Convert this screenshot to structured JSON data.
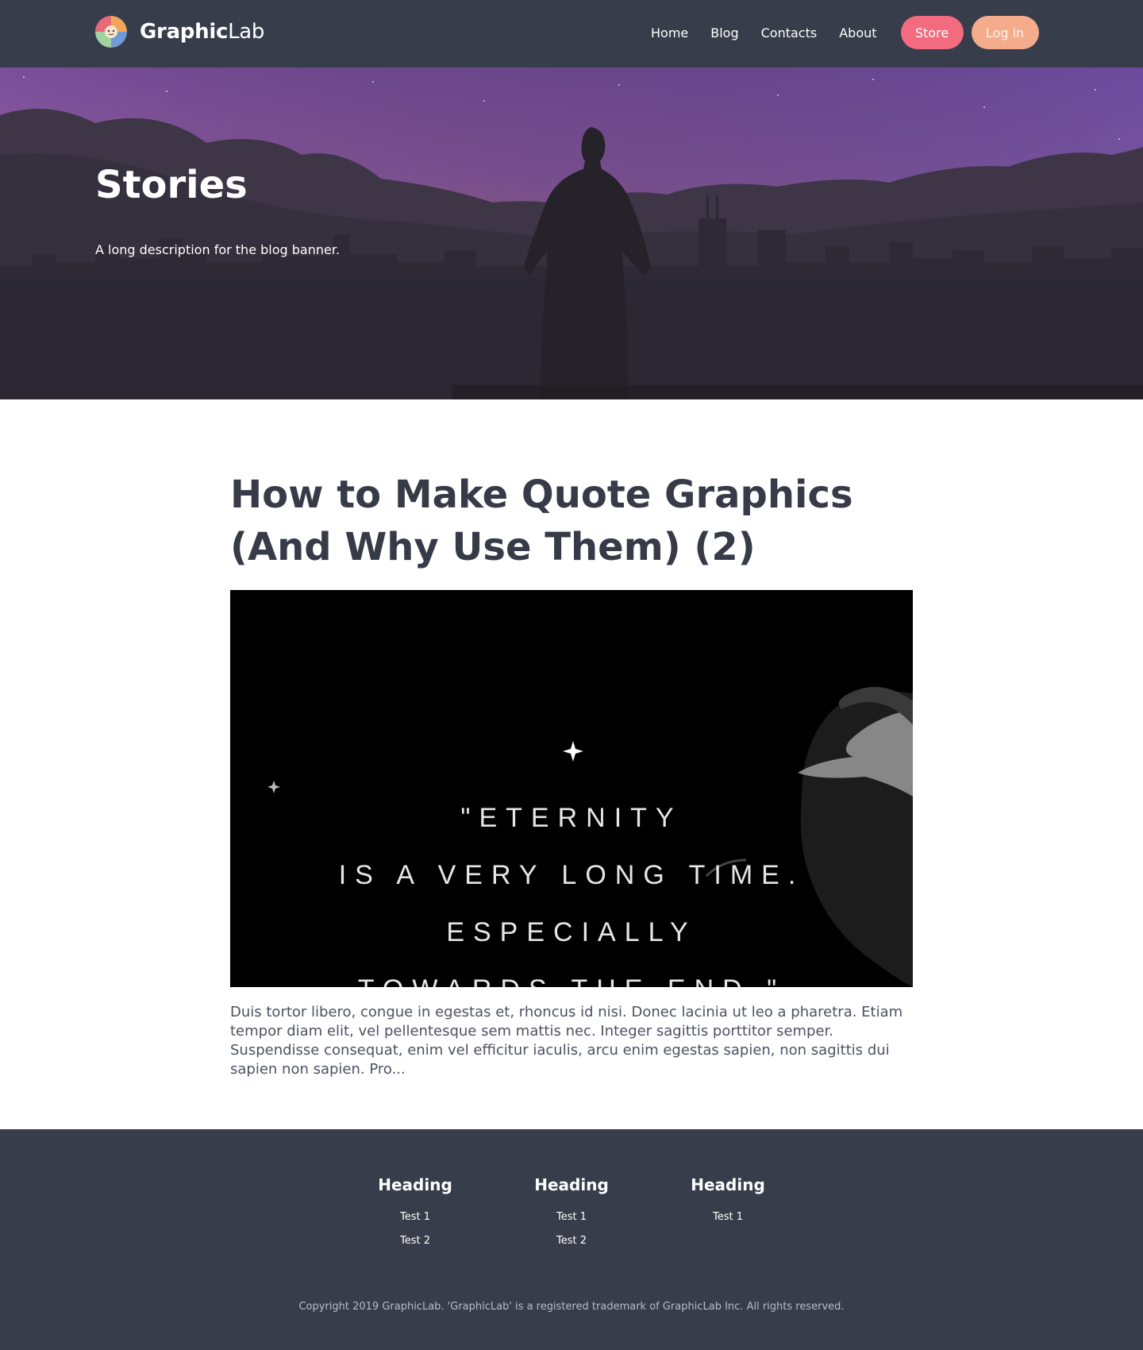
{
  "header": {
    "brand_bold": "Graphic",
    "brand_light": "Lab",
    "nav": [
      "Home",
      "Blog",
      "Contacts",
      "About"
    ],
    "store_label": "Store",
    "login_label": "Log in"
  },
  "hero": {
    "title": "Stories",
    "description": "A long description for the blog banner."
  },
  "article": {
    "title": "How to Make Quote Graphics (And Why Use Them) (2)",
    "image_quote_lines": [
      "\"ETERNITY",
      "IS A VERY LONG TIME.",
      "ESPECIALLY",
      "TOWARDS THE END.\""
    ],
    "excerpt": "Duis tortor libero, congue in egestas et, rhoncus id nisi. Donec lacinia ut leo a pharetra. Etiam tempor diam elit, vel pellentesque sem mattis nec. Integer sagittis porttitor semper. Suspendisse consequat, enim vel efficitur iaculis, arcu enim egestas sapien, non sagittis dui sapien non sapien. Pro..."
  },
  "footer": {
    "columns": [
      {
        "heading": "Heading",
        "links": [
          "Test 1",
          "Test 2"
        ]
      },
      {
        "heading": "Heading",
        "links": [
          "Test 1",
          "Test 2"
        ]
      },
      {
        "heading": "Heading",
        "links": [
          "Test 1"
        ]
      }
    ],
    "copyright": "Copyright 2019 GraphicLab. 'GraphicLab' is a registered trademark of GraphicLab Inc. All rights reserved."
  },
  "colors": {
    "header_bg": "#383d4b",
    "store_button": "#f26b7f",
    "login_button": "#f5ac8d",
    "heading_text": "#363b47"
  },
  "icons": {
    "logo": "graphiclab-logo-icon"
  }
}
